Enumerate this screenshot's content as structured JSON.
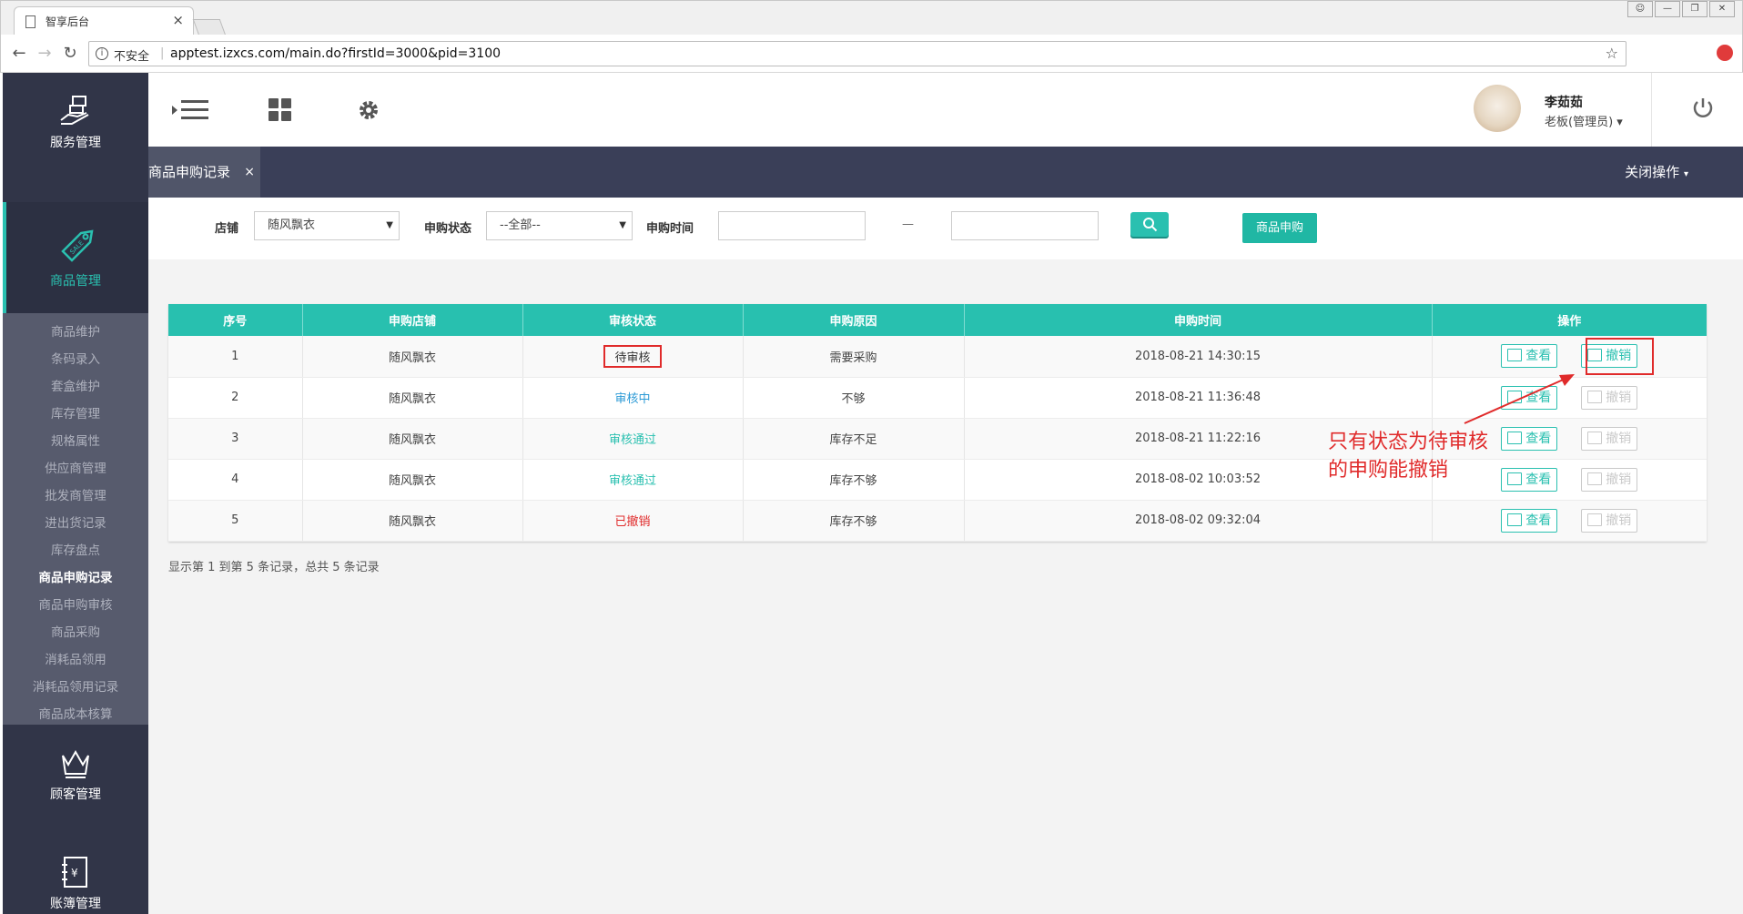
{
  "browser": {
    "tab_title": "智享后台",
    "tab_close": "×",
    "security_label": "不安全",
    "url": "apptest.izxcs.com/main.do?firstId=3000&pid=3100"
  },
  "sidebar": {
    "groups": [
      {
        "label": "服务管理",
        "icon": "hand-service-icon"
      },
      {
        "label": "商品管理",
        "icon": "sale-tag-icon",
        "active": true
      },
      {
        "label": "顾客管理",
        "icon": "crown-icon"
      },
      {
        "label": "账簿管理",
        "icon": "ledger-icon"
      }
    ],
    "submenu": [
      "商品维护",
      "条码录入",
      "套盒维护",
      "库存管理",
      "规格属性",
      "供应商管理",
      "批发商管理",
      "进出货记录",
      "库存盘点",
      "商品申购记录",
      "商品申购审核",
      "商品采购",
      "消耗品领用",
      "消耗品领用记录",
      "商品成本核算"
    ],
    "current_submenu": "商品申购记录"
  },
  "header": {
    "user_name": "李茹茹",
    "user_role": "老板(管理员)"
  },
  "tabstrip": {
    "page_tab": "商品申购记录",
    "tab_close": "×",
    "close_ops": "关闭操作"
  },
  "filter": {
    "shop_label": "店铺",
    "shop_value": "随风飘衣",
    "status_label": "申购状态",
    "status_value": "--全部--",
    "time_label": "申购时间",
    "time_sep": "—",
    "apply_button": "商品申购"
  },
  "table": {
    "headers": [
      "序号",
      "申购店铺",
      "审核状态",
      "申购原因",
      "申购时间",
      "操作"
    ],
    "rows": [
      {
        "no": "1",
        "shop": "随风飘衣",
        "status": "待审核",
        "reason": "需要采购",
        "time": "2018-08-21 14:30:15",
        "cancel_enabled": true
      },
      {
        "no": "2",
        "shop": "随风飘衣",
        "status": "审核中",
        "reason": "不够",
        "time": "2018-08-21 11:36:48",
        "cancel_enabled": false
      },
      {
        "no": "3",
        "shop": "随风飘衣",
        "status": "审核通过",
        "reason": "库存不足",
        "time": "2018-08-21 11:22:16",
        "cancel_enabled": false
      },
      {
        "no": "4",
        "shop": "随风飘衣",
        "status": "审核通过",
        "reason": "库存不够",
        "time": "2018-08-02 10:03:52",
        "cancel_enabled": false
      },
      {
        "no": "5",
        "shop": "随风飘衣",
        "status": "已撤销",
        "reason": "库存不够",
        "time": "2018-08-02 09:32:04",
        "cancel_enabled": false
      }
    ],
    "view_label": "查看",
    "cancel_label": "撤销",
    "summary": "显示第 1 到第 5 条记录，总共 5 条记录"
  },
  "annotation": {
    "line1": "只有状态为待审核",
    "line2": "的申购能撤销"
  },
  "colors": {
    "accent": "#2ac0b0",
    "sidebar_bg": "#313548",
    "tabstrip_bg": "#3a3f58",
    "highlight_red": "#e02b2b"
  }
}
